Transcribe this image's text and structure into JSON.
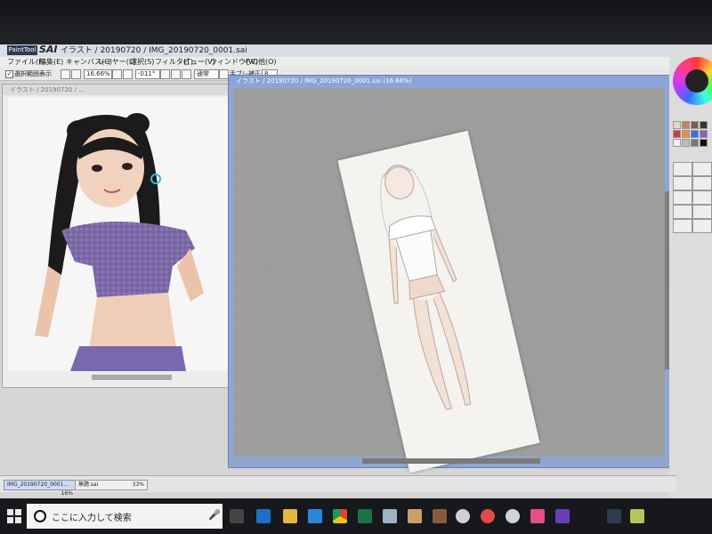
{
  "app": {
    "logo_text": "PaintTool",
    "brand": "SAI",
    "title": "イラスト / 20190720 / IMG_20190720_0001.sai"
  },
  "menu": [
    "ファイル(F)",
    "編集(E)",
    "キャンバス(C)",
    "レイヤー(L)",
    "選択(S)",
    "フィルタ(T)",
    "ビュー(V)",
    "ウィンドウ(W)",
    "その他(O)"
  ],
  "toolbar": {
    "checkbox_label": "選択範囲表示",
    "zoom": "16.66%",
    "rotate": "-011°",
    "blend_label": "通常",
    "stabilizer_label": "手ブレ補正",
    "stabilizer_value": "8"
  },
  "left_window": {
    "title": "イラスト / 20190720 / ..."
  },
  "right_window": {
    "title": "イラスト / 20190720 / IMG_20190720_0001.sai (16.66%)"
  },
  "doc_tabs": [
    {
      "label": "IMG_20190720_0001...",
      "zoom": "16%"
    },
    {
      "label": "無題.sai",
      "zoom": "33%"
    }
  ],
  "taskbar": {
    "search_placeholder": "ここに入力して検索",
    "icons": [
      "task-view-icon",
      "edge-icon",
      "file-explorer-icon",
      "ie-icon",
      "chrome-icon",
      "excel-icon",
      "notepad-icon",
      "photo-icon",
      "settings-icon",
      "paint-icon",
      "camera-icon",
      "app-icon",
      "visual-studio-icon",
      "sai-icon",
      "store-icon"
    ]
  },
  "colors": {
    "accent": "#8aa4d8",
    "taskbar": "#16181c"
  }
}
